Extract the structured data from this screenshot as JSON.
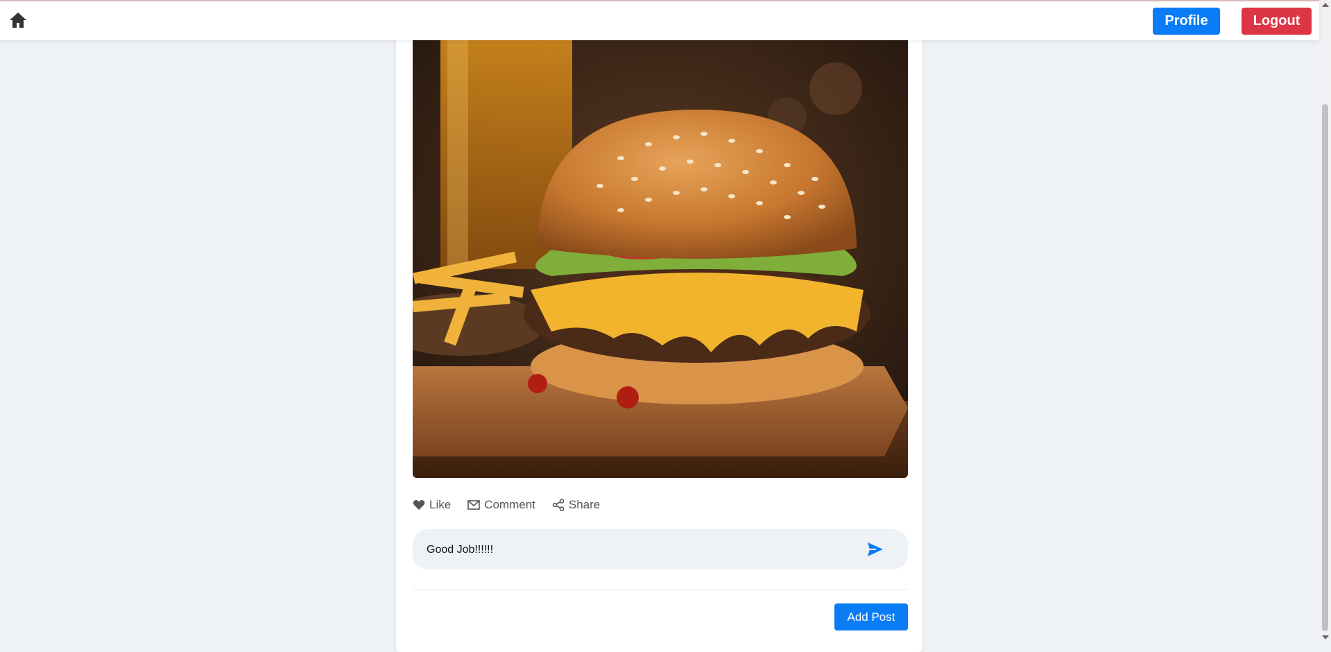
{
  "header": {
    "home_icon": "home-icon",
    "profile_label": "Profile",
    "logout_label": "Logout",
    "profile_color": "#0a7cf5",
    "logout_color": "#dc3545"
  },
  "post": {
    "image_subject": "burger-photo",
    "actions": [
      {
        "icon": "heart-icon",
        "label": "Like"
      },
      {
        "icon": "mail-icon",
        "label": "Comment"
      },
      {
        "icon": "share-icon",
        "label": "Share"
      }
    ],
    "comment": {
      "value": "Good Job!!!!!!",
      "send_icon": "send-icon"
    }
  },
  "composer": {
    "add_post_label": "Add Post"
  }
}
